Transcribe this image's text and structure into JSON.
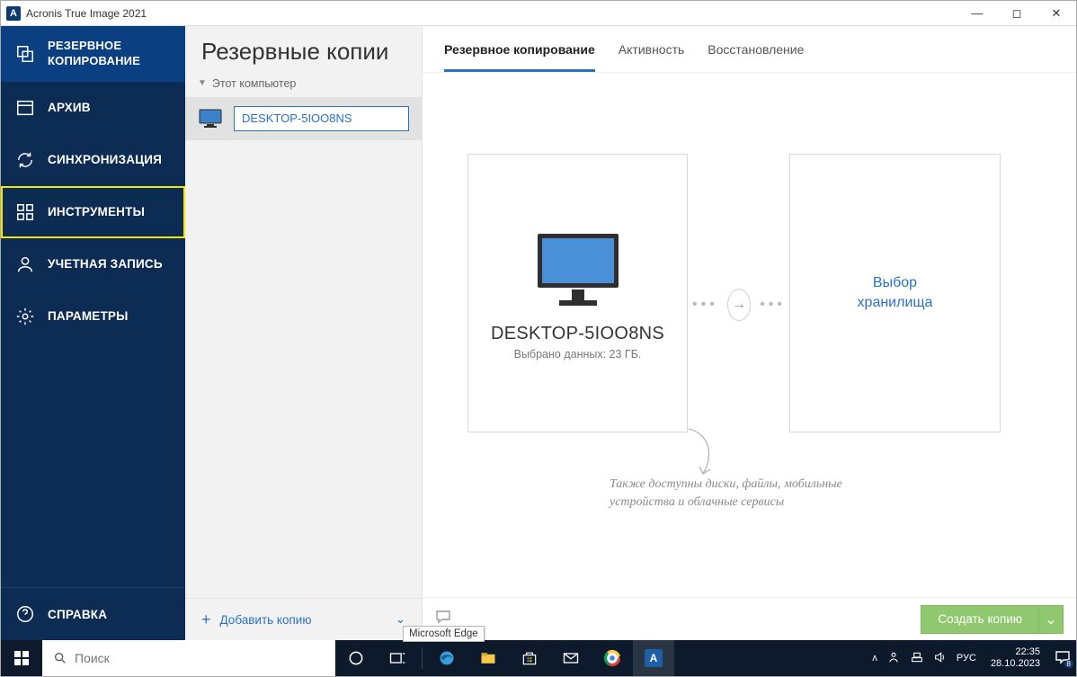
{
  "titlebar": {
    "app_title": "Acronis True Image 2021",
    "app_icon_letter": "A"
  },
  "sidebar": {
    "items": [
      {
        "label": "РЕЗЕРВНОЕ КОПИРОВАНИЕ"
      },
      {
        "label": "АРХИВ"
      },
      {
        "label": "СИНХРОНИЗАЦИЯ"
      },
      {
        "label": "ИНСТРУМЕНТЫ"
      },
      {
        "label": "УЧЕТНАЯ ЗАПИСЬ"
      },
      {
        "label": "ПАРАМЕТРЫ"
      }
    ],
    "help_label": "СПРАВКА"
  },
  "listpane": {
    "heading": "Резервные копии",
    "category": "Этот компьютер",
    "selected_backup_name": "DESKTOP-5IOO8NS",
    "add_button": "Добавить копию"
  },
  "tabs": [
    {
      "label": "Резервное копирование",
      "active": true
    },
    {
      "label": "Активность",
      "active": false
    },
    {
      "label": "Восстановление",
      "active": false
    }
  ],
  "source_card": {
    "name": "DESKTOP-5IOO8NS",
    "subtitle": "Выбрано данных: 23 ГБ."
  },
  "destination_card": {
    "label_line1": "Выбор",
    "label_line2": "хранилища"
  },
  "hint_text": "Также доступны диски, файлы, мобильные устройства и облачные сервисы",
  "bottombar": {
    "create_label": "Создать копию"
  },
  "tooltip": "Microsoft Edge",
  "taskbar": {
    "search_placeholder": "Поиск",
    "lang": "РУС",
    "time": "22:35",
    "date": "28.10.2023",
    "notif_count": "8"
  }
}
